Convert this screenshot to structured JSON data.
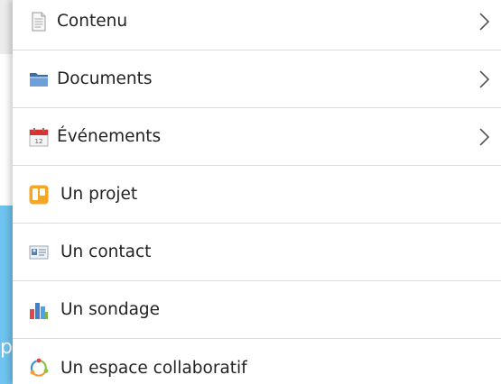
{
  "background": {
    "accent_color": "#6ec4f0",
    "partial_letter": "p"
  },
  "menu": {
    "items": [
      {
        "label": "Contenu",
        "icon": "document-icon",
        "has_submenu": true
      },
      {
        "label": "Documents",
        "icon": "folder-icon",
        "has_submenu": true
      },
      {
        "label": "Événements",
        "icon": "calendar-icon",
        "has_submenu": true
      },
      {
        "label": "Un projet",
        "icon": "project-board-icon",
        "has_submenu": false
      },
      {
        "label": "Un contact",
        "icon": "contact-card-icon",
        "has_submenu": false
      },
      {
        "label": "Un sondage",
        "icon": "bar-chart-icon",
        "has_submenu": false
      },
      {
        "label": "Un espace collaboratif",
        "icon": "collaborative-space-icon",
        "has_submenu": false
      }
    ]
  }
}
